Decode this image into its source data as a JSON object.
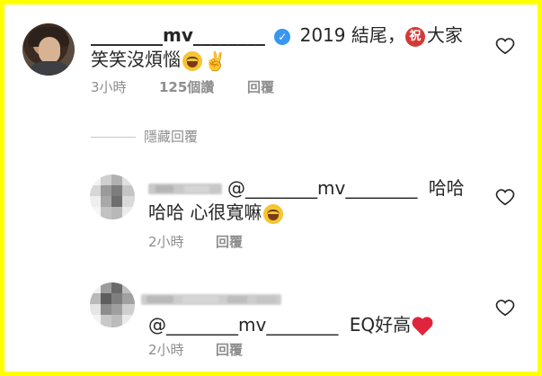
{
  "main_comment": {
    "username": "________mv________",
    "text_after_badge": "2019 結尾，",
    "seal_char": "祝",
    "text_line1_end": "大家",
    "text_line2": "笑笑沒煩惱",
    "time": "3小時",
    "likes": "125個讚",
    "reply": "回覆"
  },
  "hidden_replies": {
    "label": "隱藏回覆"
  },
  "reply1": {
    "mention": "@________mv________",
    "text_line1_end": "哈哈",
    "text_line2": "哈哈 心很寬嘛",
    "time": "2小時",
    "reply": "回覆"
  },
  "reply2": {
    "mention": "@________mv________",
    "text_end": "EQ好高",
    "time": "2小時",
    "reply": "回覆"
  },
  "colors": {
    "border": "#ffff00",
    "verified": "#3897f0",
    "text": "#262626",
    "meta": "#8e8e8e",
    "heart": "#e0243b"
  },
  "icons": {
    "like": "heart-outline-icon",
    "verified": "verified-badge-icon"
  }
}
